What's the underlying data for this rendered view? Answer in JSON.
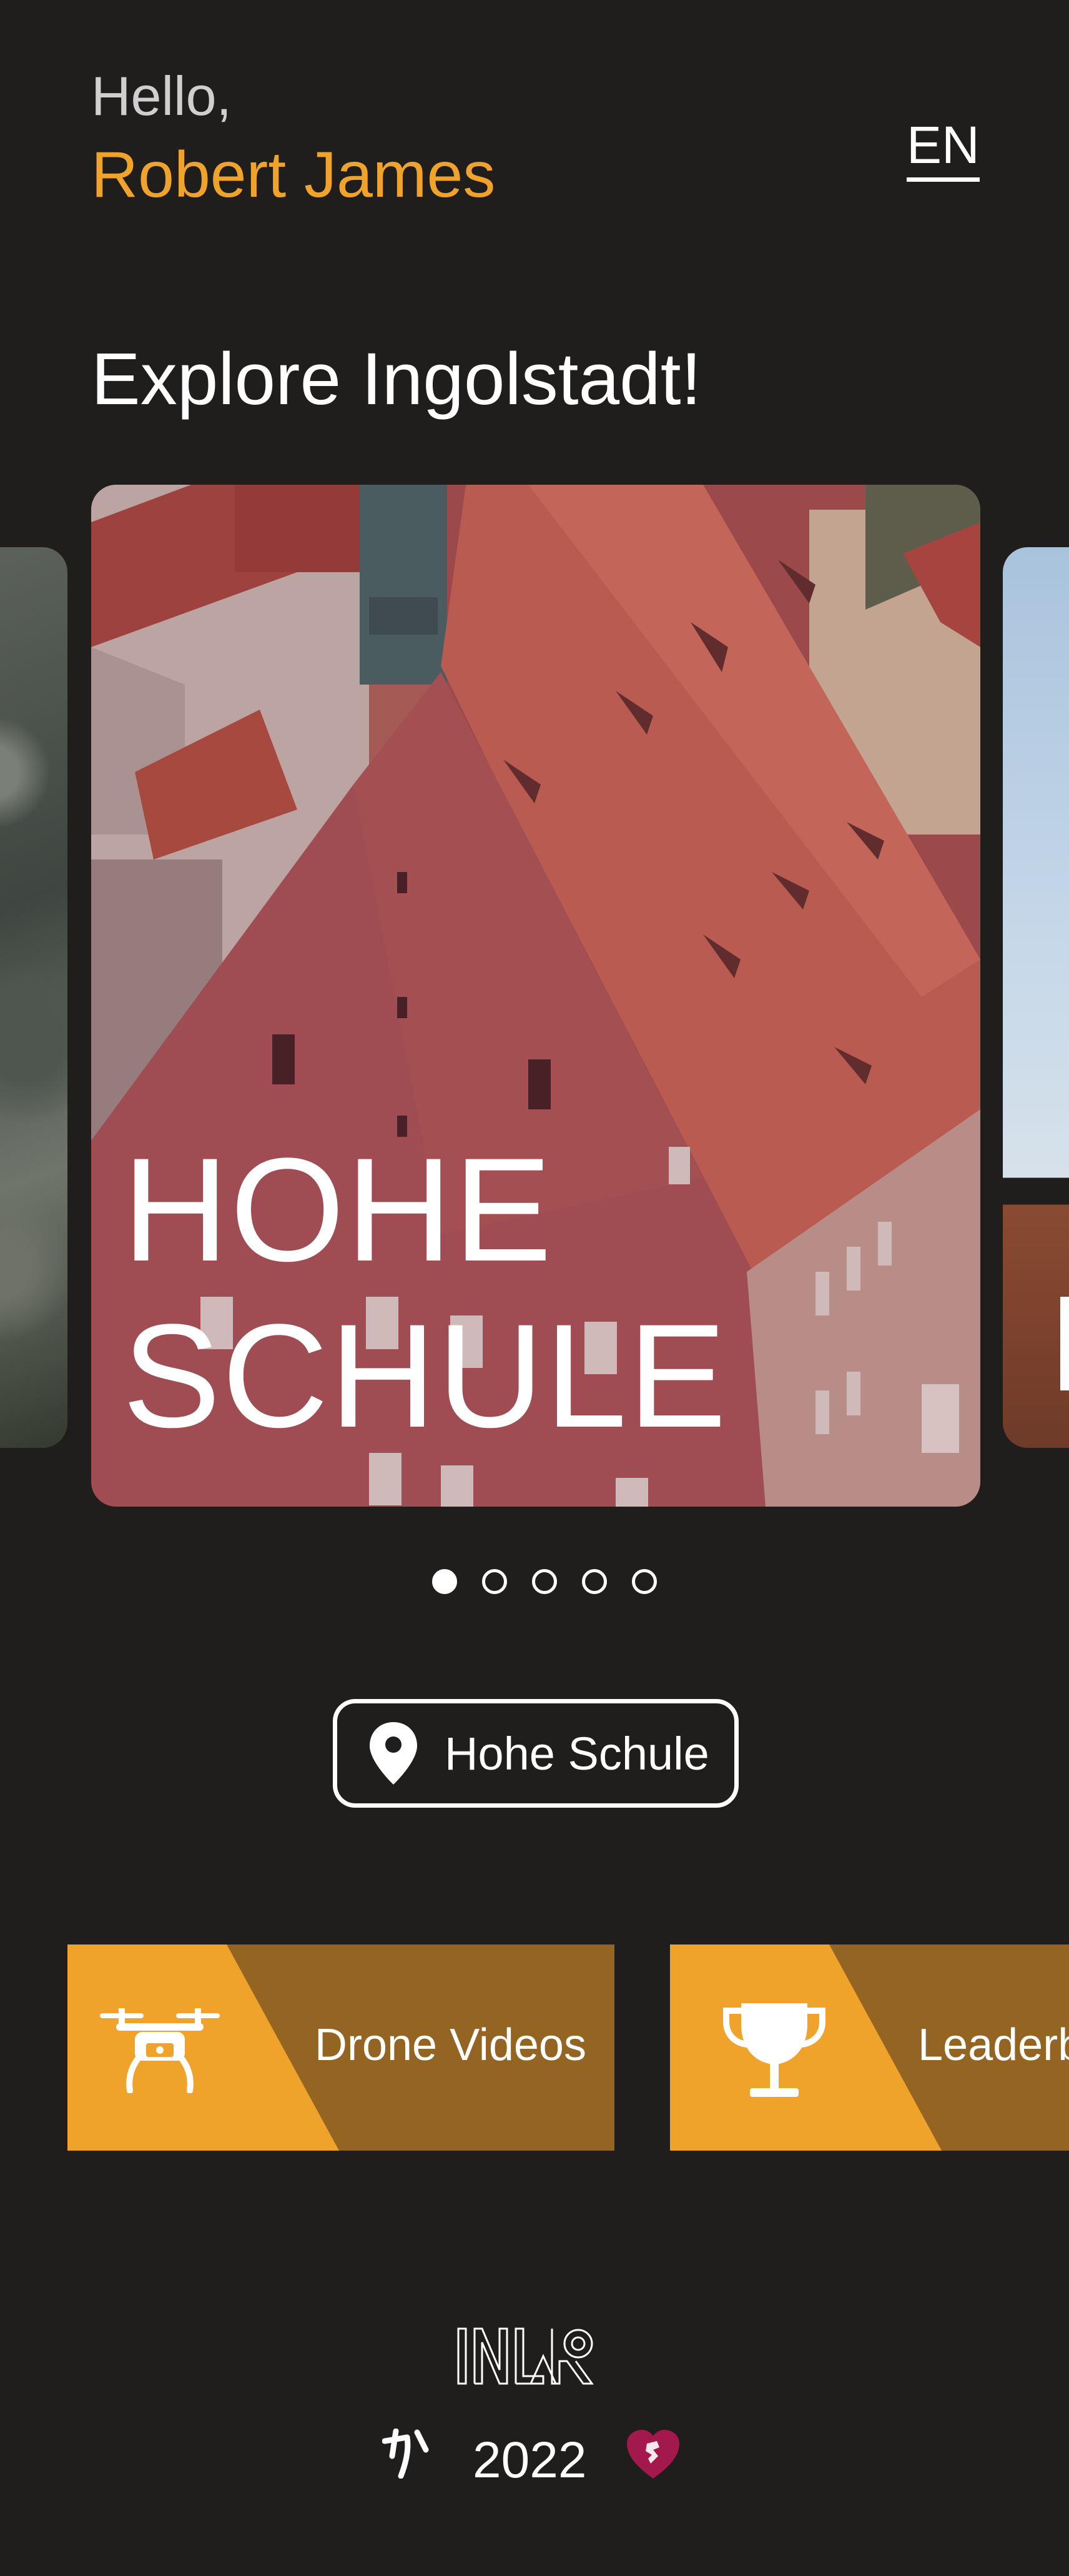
{
  "greeting": {
    "hello": "Hello,",
    "name": "Robert James"
  },
  "language": {
    "code": "EN"
  },
  "heading": "Explore Ingolstadt!",
  "carousel": {
    "active_card": {
      "title_line1": "HOHE",
      "title_line2": "SCHULE"
    },
    "dots_total": 5,
    "dots_active_index": 0
  },
  "location": {
    "icon": "map-pin-icon",
    "label": "Hohe Schule"
  },
  "features": [
    {
      "icon": "drone-icon",
      "label": "Drone Videos"
    },
    {
      "icon": "trophy-icon",
      "label": "Leaderb"
    }
  ],
  "footer": {
    "logo_text": "INAR",
    "year": "2022"
  },
  "colors": {
    "background": "#201d1d",
    "accent": "#f0a32a",
    "tile_dark": "#946423",
    "heart": "#a3194e"
  }
}
